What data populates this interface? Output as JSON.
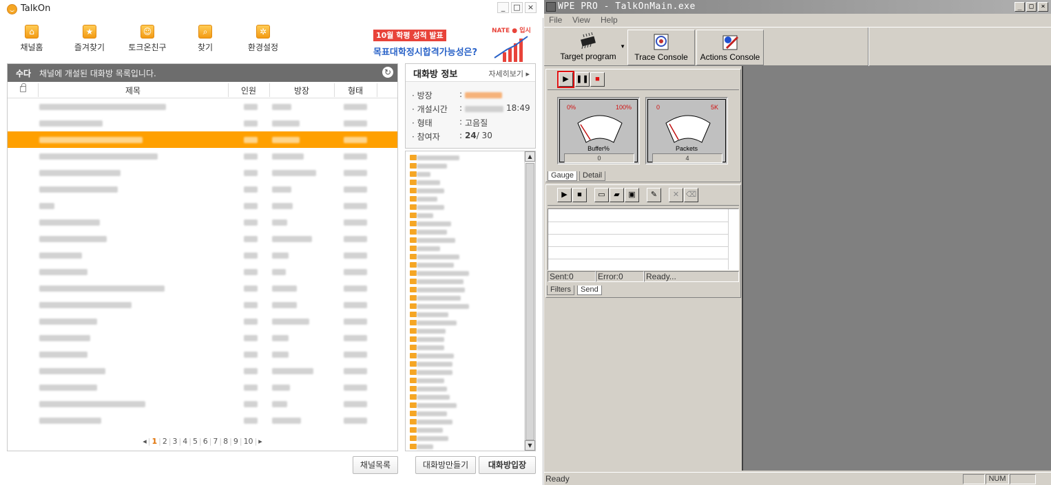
{
  "talkon": {
    "title": "TalkOn",
    "window_controls": [
      "_",
      "□",
      "×"
    ],
    "toolbar": [
      {
        "label": "채널홈",
        "icon": "channel-home-icon"
      },
      {
        "label": "즐겨찾기",
        "icon": "favorites-star-icon"
      },
      {
        "label": "토크온친구",
        "icon": "friends-smile-icon"
      },
      {
        "label": "찾기",
        "icon": "search-icon"
      },
      {
        "label": "환경설정",
        "icon": "settings-gear-icon"
      }
    ],
    "ad": {
      "tag": "10월 학평 성적 발표",
      "brand": "NATE ● 입시",
      "headline": "목표대학정시합격가능성은?"
    },
    "list": {
      "tag": "수다",
      "description": "채널에 개설된 대화방 목록입니다.",
      "columns": {
        "title": "제목",
        "members": "인원",
        "owner": "방장",
        "type": "형태"
      },
      "row_count": 20,
      "selected_row": 2,
      "pagination": {
        "pages": [
          "1",
          "2",
          "3",
          "4",
          "5",
          "6",
          "7",
          "8",
          "9",
          "10"
        ],
        "current": "1",
        "prev": "◂",
        "next": "▸"
      }
    },
    "buttons": {
      "channel_list": "채널목록",
      "create_room": "대화방만들기",
      "enter_room": "대화방입장"
    },
    "info": {
      "title": "대화방 정보",
      "more": "자세히보기 ▸",
      "fields": [
        {
          "label": "· 방장",
          "value": ""
        },
        {
          "label": "· 개설시간",
          "value": "18:49"
        },
        {
          "label": "· 형태",
          "value": "고음질"
        },
        {
          "label": "· 참여자",
          "value_bold": "24",
          "value_rest": "/ 30"
        }
      ]
    },
    "scroll": {
      "up": "▲",
      "down": "▼"
    }
  },
  "wpe": {
    "title": "WPE PRO - TalkOnMain.exe",
    "window_controls": [
      "_",
      "□",
      "×"
    ],
    "menu": [
      "File",
      "View",
      "Help"
    ],
    "toolbar": [
      {
        "label": "Target program",
        "icon": "chip-icon"
      },
      {
        "label": "Trace Console",
        "icon": "trace-console-icon"
      },
      {
        "label": "Actions Console",
        "icon": "actions-console-icon"
      }
    ],
    "capture_controls": [
      "▶",
      "❚❚",
      "■"
    ],
    "gauges": [
      {
        "name": "Buffer%",
        "min": "0%",
        "max": "100%",
        "value": "0"
      },
      {
        "name": "Packets",
        "min": "0",
        "max": "5K",
        "value": "4"
      }
    ],
    "gauge_tabs": [
      "Gauge",
      "Detail"
    ],
    "filter_controls": [
      "▶",
      "■",
      "new",
      "open",
      "save",
      "edit",
      "delete",
      "trash"
    ],
    "send_status": {
      "sent": "Sent:0",
      "error": "Error:0",
      "state": "Ready..."
    },
    "send_tabs": [
      "Filters",
      "Send"
    ],
    "statusbar": {
      "text": "Ready",
      "num": "NUM"
    }
  }
}
